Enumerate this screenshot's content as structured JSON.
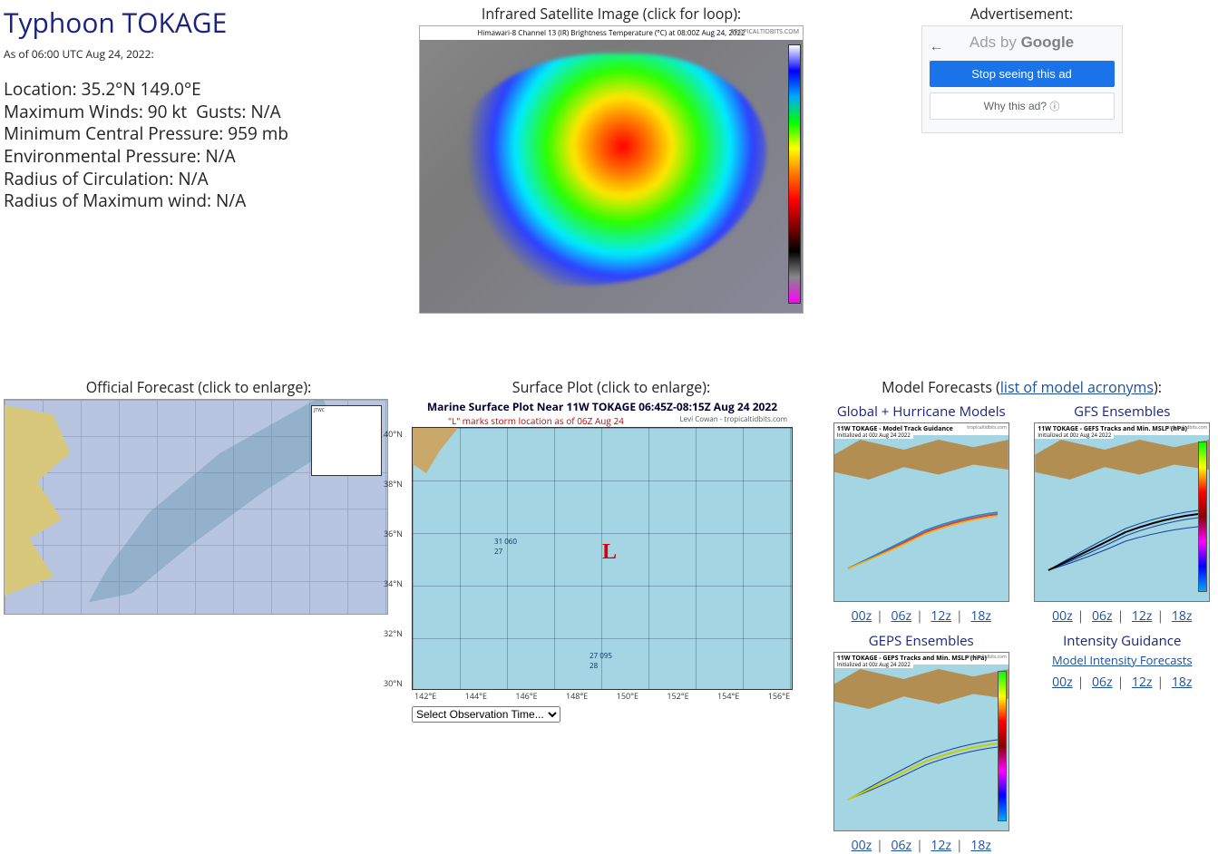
{
  "storm": {
    "title": "Typhoon TOKAGE",
    "asof": "As of 06:00 UTC Aug 24, 2022:",
    "location_label": "Location:",
    "location_value": "35.2°N 149.0°E",
    "maxwind_label": "Maximum Winds:",
    "maxwind_value": "90 kt",
    "gusts_label": "Gusts:",
    "gusts_value": "N/A",
    "pressure_label": "Minimum Central Pressure:",
    "pressure_value": "959 mb",
    "envpress_label": "Environmental Pressure:",
    "envpress_value": "N/A",
    "roci_label": "Radius of Circulation:",
    "roci_value": "N/A",
    "rmw_label": "Radius of Maximum wind:",
    "rmw_value": "N/A"
  },
  "satellite": {
    "heading": "Infrared Satellite Image (click for loop):",
    "caption": "Himawari-8 Channel 13 (IR) Brightness Temperature (°C) at 08:00Z Aug 24, 2022",
    "source": "TROPICALTIDBITS.COM"
  },
  "ad": {
    "heading": "Advertisement:",
    "ads_by_left": "Ads by ",
    "ads_by_brand": "Google",
    "stop_btn": "Stop seeing this ad",
    "why_btn": "Why this ad? ",
    "back": "←"
  },
  "forecast": {
    "heading": "Official Forecast (click to enlarge):"
  },
  "surface": {
    "heading": "Surface Plot (click to enlarge):",
    "title": "Marine Surface Plot Near 11W TOKAGE 06:45Z-08:15Z Aug 24 2022",
    "subtitle": "\"L\" marks storm location as of 06Z Aug 24",
    "credit": "Levi Cowan - tropicaltidbits.com",
    "L": "L",
    "obs1a": "31  060",
    "obs1b": "27",
    "obs2a": "27  095",
    "obs2b": "28",
    "x": [
      "142°E",
      "144°E",
      "146°E",
      "148°E",
      "150°E",
      "152°E",
      "154°E",
      "156°E"
    ],
    "y": [
      "40°N",
      "38°N",
      "36°N",
      "34°N",
      "32°N",
      "30°N"
    ],
    "select_placeholder": "Select Observation Time..."
  },
  "models": {
    "heading_pre": "Model Forecasts (",
    "heading_link": "list of model acronyms",
    "heading_post": "):",
    "global": {
      "title": "Global + Hurricane Models",
      "thumb_title": "11W TOKAGE - Model Track Guidance",
      "thumb_sub": "Initialized at 00z Aug 24 2022"
    },
    "gfs": {
      "title": "GFS Ensembles",
      "thumb_title": "11W TOKAGE - GEFS Tracks and Min. MSLP (hPa)",
      "thumb_sub": "Initialized at 00z Aug 24 2022"
    },
    "geps": {
      "title": "GEPS Ensembles",
      "thumb_title": "11W TOKAGE - GEPS Tracks and Min. MSLP (hPa)",
      "thumb_sub": "Initialized at 00z Aug 24 2022"
    },
    "intensity": {
      "title": "Intensity Guidance",
      "link": "Model Intensity Forecasts"
    },
    "thumb_credit": "tropicaltidbits.com",
    "runs": {
      "r00": "00z",
      "r06": "06z",
      "r12": "12z",
      "r18": "18z"
    }
  }
}
